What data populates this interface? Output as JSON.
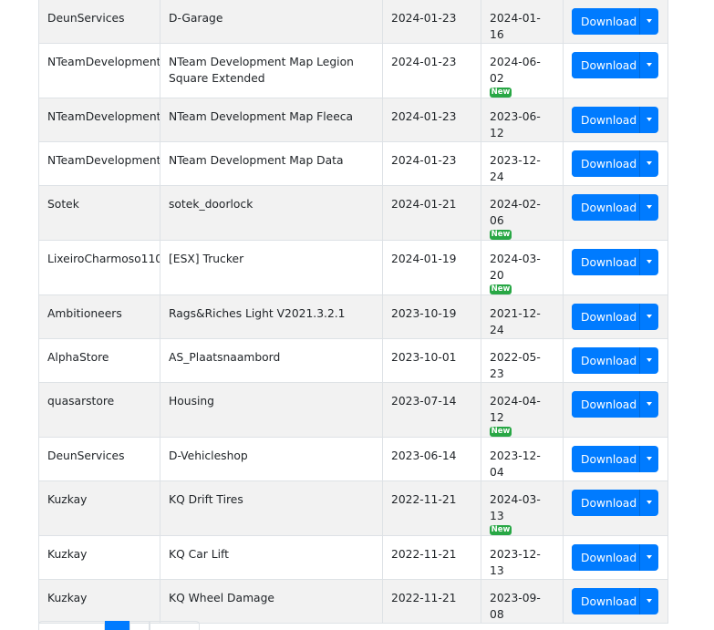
{
  "actions": {
    "download_label": "Download",
    "new_badge": "New"
  },
  "rows": [
    {
      "author": "DeunServices",
      "name": "D-Garage",
      "added": "2024-01-23",
      "updated": "2024-01-16",
      "is_new": false
    },
    {
      "author": "NTeamDevelopment",
      "name": "NTeam Development Map Legion Square Extended",
      "added": "2024-01-23",
      "updated": "2024-06-02",
      "is_new": true
    },
    {
      "author": "NTeamDevelopment",
      "name": "NTeam Development Map Fleeca",
      "added": "2024-01-23",
      "updated": "2023-06-12",
      "is_new": false
    },
    {
      "author": "NTeamDevelopment",
      "name": "NTeam Development Map Data",
      "added": "2024-01-23",
      "updated": "2023-12-24",
      "is_new": false
    },
    {
      "author": "Sotek",
      "name": "sotek_doorlock",
      "added": "2024-01-21",
      "updated": "2024-02-06",
      "is_new": true
    },
    {
      "author": "LixeiroCharmoso1104",
      "name": "[ESX] Trucker",
      "added": "2024-01-19",
      "updated": "2024-03-20",
      "is_new": true
    },
    {
      "author": "Ambitioneers",
      "name": "Rags&Riches Light V2021.3.2.1",
      "added": "2023-10-19",
      "updated": "2021-12-24",
      "is_new": false
    },
    {
      "author": "AlphaStore",
      "name": "AS_Plaatsnaambord",
      "added": "2023-10-01",
      "updated": "2022-05-23",
      "is_new": false
    },
    {
      "author": "quasarstore",
      "name": "Housing",
      "added": "2023-07-14",
      "updated": "2024-04-12",
      "is_new": true
    },
    {
      "author": "DeunServices",
      "name": "D-Vehicleshop",
      "added": "2023-06-14",
      "updated": "2023-12-04",
      "is_new": false
    },
    {
      "author": "Kuzkay",
      "name": "KQ Drift Tires",
      "added": "2022-11-21",
      "updated": "2024-03-13",
      "is_new": true
    },
    {
      "author": "Kuzkay",
      "name": "KQ Car Lift",
      "added": "2022-11-21",
      "updated": "2023-12-13",
      "is_new": false
    },
    {
      "author": "Kuzkay",
      "name": "KQ Wheel Damage",
      "added": "2022-11-21",
      "updated": "2023-09-08",
      "is_new": false
    }
  ],
  "colors": {
    "primary": "#007bff",
    "success": "#28a745",
    "stripe": "#f2f2f2",
    "border": "#dee2e6"
  },
  "icons": {
    "split_caret": "caret-down-icon"
  }
}
